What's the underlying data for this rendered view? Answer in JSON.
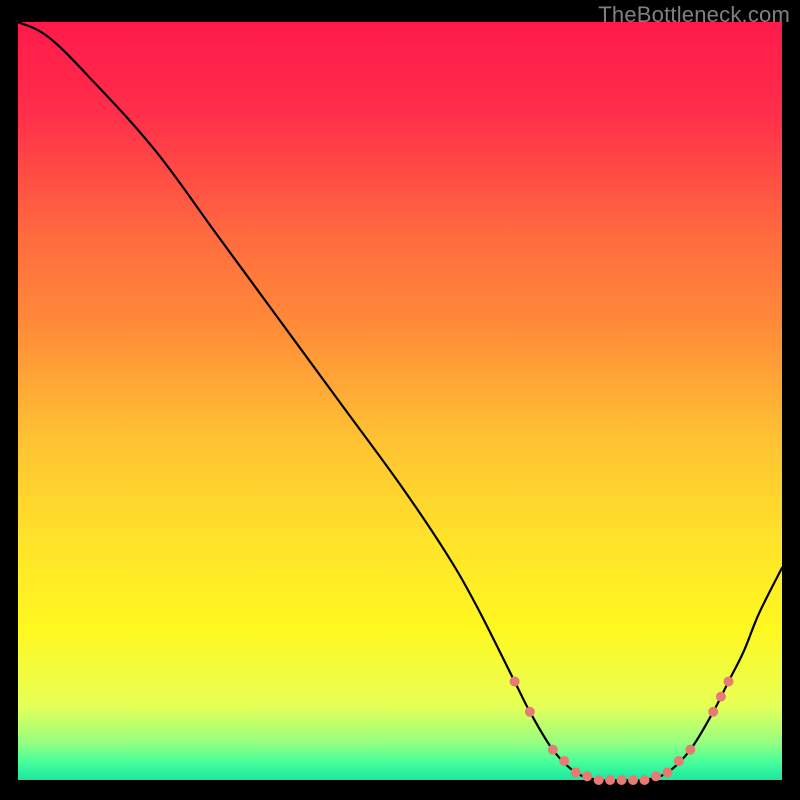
{
  "branding": "TheBottleneck.com",
  "colors": {
    "curve": "#000000",
    "marker": "#e77b74",
    "background_top": "#ff1a4b",
    "background_bottom": "#18e8a0"
  },
  "chart_data": {
    "type": "line",
    "title": "",
    "xlabel": "",
    "ylabel": "",
    "xlim": [
      0,
      100
    ],
    "ylim": [
      0,
      100
    ],
    "grid": false,
    "legend": false,
    "x": [
      0,
      4,
      10,
      18,
      26,
      34,
      42,
      50,
      56,
      60,
      65,
      67,
      70,
      73,
      76,
      79,
      82,
      85,
      88,
      91,
      93,
      95,
      97,
      100
    ],
    "values": [
      100,
      98,
      92,
      83,
      72,
      61,
      50,
      39,
      30,
      23,
      13,
      9,
      4,
      1,
      0,
      0,
      0,
      1,
      4,
      9,
      13,
      17,
      22,
      28
    ],
    "markers": {
      "x": [
        65,
        67,
        70,
        71.5,
        73,
        74.5,
        76,
        77.5,
        79,
        80.5,
        82,
        83.5,
        85,
        86.5,
        88,
        91,
        92,
        93
      ],
      "style": "dots",
      "color": "#e77b74",
      "radius": 5
    }
  }
}
